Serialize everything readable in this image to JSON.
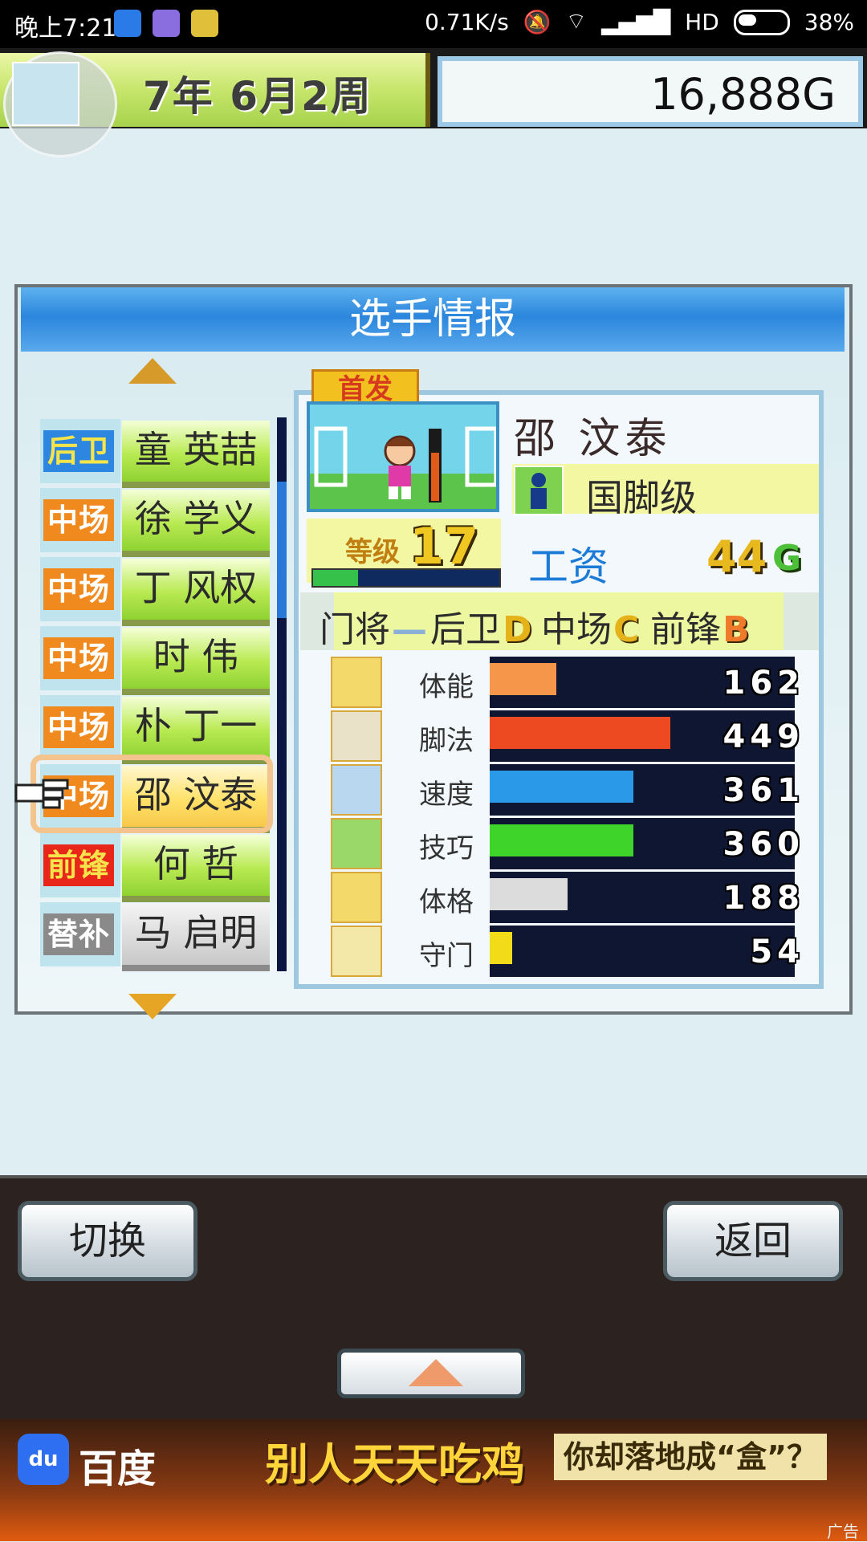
{
  "status_bar": {
    "time": "晚上7:21",
    "network_speed": "0.71K/s",
    "signal_label": "HD",
    "battery": "38%"
  },
  "header": {
    "date": "7年 6月2周",
    "money": "16,888G"
  },
  "panel": {
    "title": "选手情报"
  },
  "roster": [
    {
      "position": "后卫",
      "name": "童 英喆",
      "pos_color": "#2d86e0",
      "pos_text": "#f5e44a"
    },
    {
      "position": "中场",
      "name": "徐 学义",
      "pos_color": "#f08a1e",
      "pos_text": "#ffffff"
    },
    {
      "position": "中场",
      "name": "丁 风权",
      "pos_color": "#f08a1e",
      "pos_text": "#ffffff"
    },
    {
      "position": "中场",
      "name": "时 伟",
      "pos_color": "#f08a1e",
      "pos_text": "#ffffff"
    },
    {
      "position": "中场",
      "name": "朴 丁一",
      "pos_color": "#f08a1e",
      "pos_text": "#ffffff"
    },
    {
      "position": "中场",
      "name": "邵 汶泰",
      "pos_color": "#f08a1e",
      "pos_text": "#ffffff",
      "selected": true
    },
    {
      "position": "前锋",
      "name": "何 哲",
      "pos_color": "#e8261a",
      "pos_text": "#f5e44a"
    },
    {
      "position": "替补",
      "name": "马 启明",
      "pos_color": "#8a8a8a",
      "pos_text": "#ffffff",
      "reserve": true
    }
  ],
  "player": {
    "tag": "首发",
    "name": "邵 汶泰",
    "grade": "国脚级",
    "level_label": "等级",
    "level": "17",
    "exp_fraction": 0.24,
    "salary_label": "工资",
    "salary": "44",
    "salary_unit": "G",
    "aptitudes": [
      {
        "label": "门将",
        "grade": "—"
      },
      {
        "label": "后卫",
        "grade": "D"
      },
      {
        "label": "中场",
        "grade": "C"
      },
      {
        "label": "前锋",
        "grade": "B"
      }
    ],
    "stats": [
      {
        "label": "体能",
        "value": "162",
        "fraction": 0.18,
        "color": "#f5964a",
        "icon": "battery-icon"
      },
      {
        "label": "脚法",
        "value": "449",
        "fraction": 0.49,
        "color": "#ee4a22",
        "icon": "boot-icon"
      },
      {
        "label": "速度",
        "value": "361",
        "fraction": 0.39,
        "color": "#2a9ae8",
        "icon": "runner-icon"
      },
      {
        "label": "技巧",
        "value": "360",
        "fraction": 0.39,
        "color": "#3ed42a",
        "icon": "dribble-icon"
      },
      {
        "label": "体格",
        "value": "188",
        "fraction": 0.21,
        "color": "#dcdcdc",
        "icon": "muscle-icon"
      },
      {
        "label": "守门",
        "value": "54",
        "fraction": 0.06,
        "color": "#f2dc1a",
        "icon": "glove-icon"
      }
    ]
  },
  "controls": {
    "switch_label": "切换",
    "back_label": "返回"
  },
  "ad": {
    "logo_text": "du",
    "brand": "百度",
    "headline": "别人天天吃鸡",
    "subline": "你却落地成“盒”？",
    "tag": "广告"
  }
}
